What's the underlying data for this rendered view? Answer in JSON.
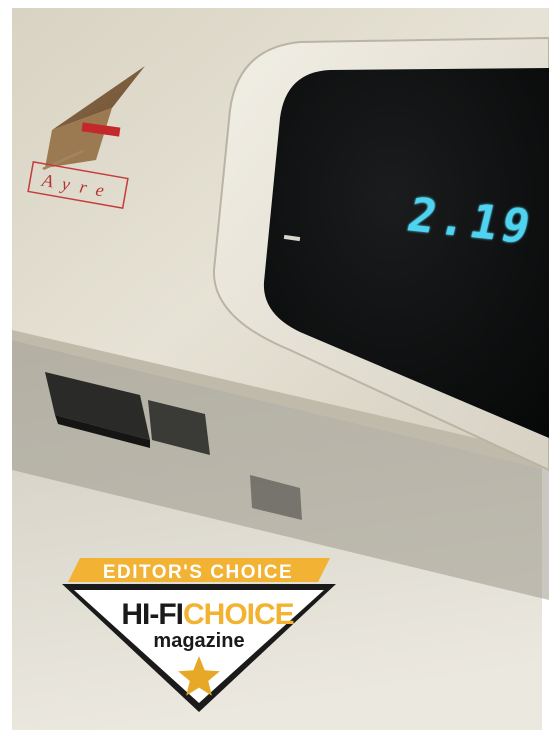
{
  "product": {
    "brand_logo_text": "Ayre",
    "display_readout": "2.19",
    "display_color": "#4fd3f0"
  },
  "badge": {
    "banner": "EDITOR'S CHOICE",
    "hifi": "HI-FI",
    "choice": "CHOICE",
    "magazine": "magazine",
    "colors": {
      "banner_gold": "#f2b233",
      "choice_gold": "#f3b22f",
      "star_gold": "#e7a827",
      "ink": "#1a1a1a"
    }
  }
}
